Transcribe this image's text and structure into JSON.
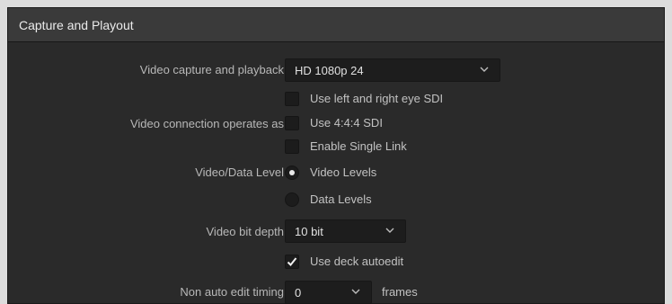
{
  "panel": {
    "title": "Capture and Playout"
  },
  "fields": {
    "capture_label": "Video capture and playback",
    "capture_value": "HD 1080p 24",
    "connection_label": "Video connection operates as",
    "connection_options": [
      {
        "label": "Use left and right eye SDI",
        "checked": false
      },
      {
        "label": "Use 4:4:4 SDI",
        "checked": false
      },
      {
        "label": "Enable Single Link",
        "checked": false
      }
    ],
    "level_label": "Video/Data Level",
    "level_options": [
      {
        "label": "Video Levels",
        "selected": true
      },
      {
        "label": "Data Levels",
        "selected": false
      }
    ],
    "bitdepth_label": "Video bit depth",
    "bitdepth_value": "10 bit",
    "autoedit": {
      "label": "Use deck autoedit",
      "checked": true
    },
    "timing_label": "Non auto edit timing",
    "timing_value": "0",
    "timing_unit": "frames"
  },
  "icons": {
    "dropdown": "chevron-down-icon",
    "check": "checkmark-icon"
  }
}
